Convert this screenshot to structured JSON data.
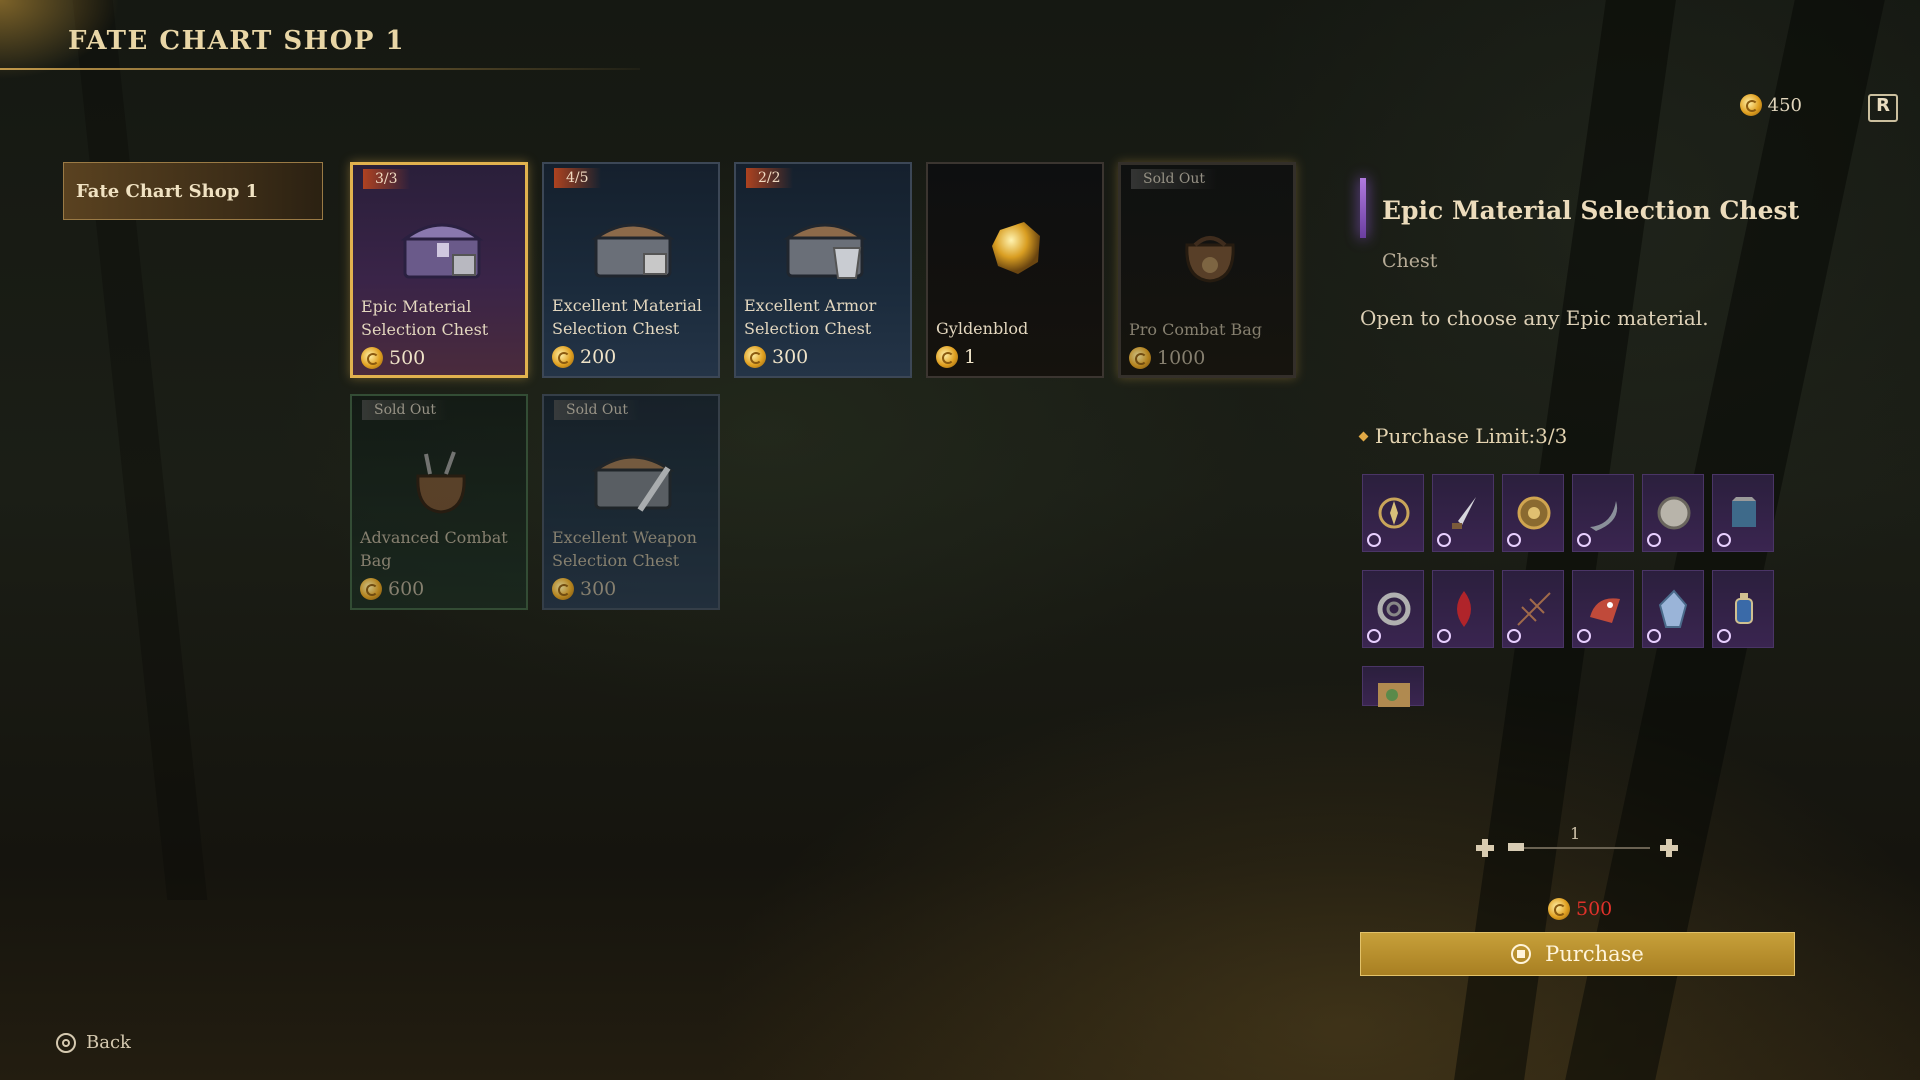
{
  "header": {
    "title": "FATE CHART SHOP 1"
  },
  "currency": {
    "amount": "450",
    "icon": "fate-coin-icon",
    "extra_icon": "r-button-icon"
  },
  "tabs": [
    {
      "label": "Fate Chart Shop 1",
      "active": true
    }
  ],
  "shop_items": [
    {
      "name": "Epic Material Selection Chest",
      "price": "500",
      "badge": "3/3",
      "rarity": "epic",
      "selected": true,
      "sold_out": false
    },
    {
      "name": "Excellent Material Selection Chest",
      "price": "200",
      "badge": "4/5",
      "rarity": "excellent",
      "selected": false,
      "sold_out": false
    },
    {
      "name": "Excellent Armor Selection Chest",
      "price": "300",
      "badge": "2/2",
      "rarity": "excellent",
      "selected": false,
      "sold_out": false
    },
    {
      "name": "Gyldenblod",
      "price": "1",
      "badge": "",
      "rarity": "common",
      "selected": false,
      "sold_out": false
    },
    {
      "name": "Pro Combat Bag",
      "price": "1000",
      "badge": "Sold Out",
      "rarity": "common",
      "selected": false,
      "sold_out": true
    },
    {
      "name": "Advanced Combat Bag",
      "price": "600",
      "badge": "Sold Out",
      "rarity": "uncommon",
      "selected": false,
      "sold_out": true
    },
    {
      "name": "Excellent Weapon Selection Chest",
      "price": "300",
      "badge": "Sold Out",
      "rarity": "excellent",
      "selected": false,
      "sold_out": true
    }
  ],
  "detail": {
    "title": "Epic Material Selection Chest",
    "type": "Chest",
    "description": "Open to choose any Epic material.",
    "purchase_limit": "Purchase Limit:3/3",
    "materials": [
      "compass-icon",
      "dagger-icon",
      "ornament-icon",
      "horn-icon",
      "coin-icon",
      "banner-icon",
      "coil-icon",
      "feather-icon",
      "web-icon",
      "beast-skull-icon",
      "crystal-icon",
      "lantern-icon",
      "scroll-icon"
    ]
  },
  "quantity": {
    "value": "1"
  },
  "total": {
    "amount": "500"
  },
  "buttons": {
    "purchase": "Purchase",
    "back": "Back"
  },
  "colors": {
    "accent_gold": "#c7a03a",
    "epic_purple": "#3a2550",
    "excellent_blue": "#1b2b3c",
    "price_red": "#e0312a"
  }
}
